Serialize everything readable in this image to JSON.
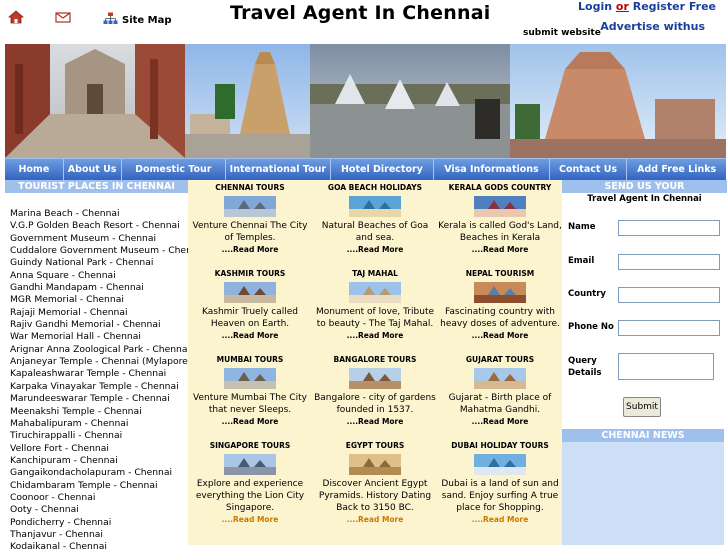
{
  "header": {
    "home_icon": "home-icon",
    "mail_icon": "mail-icon",
    "sitemap_icon": "sitemap-icon",
    "sitemap_label": "Site Map",
    "title": "Travel Agent In Chennai",
    "login_label": "Login",
    "or_label": "or",
    "register_label": "Register Free",
    "advertise_label": "Advertise withus",
    "submit_website_label": "submit website"
  },
  "nav": {
    "items": [
      "Home",
      "About Us",
      "Domestic Tour",
      "International Tour",
      "Hotel Directory",
      "Visa Informations",
      "Contact Us",
      "Add Free Links"
    ]
  },
  "left": {
    "heading": "TOURIST PLACES IN CHENNAI",
    "places": [
      "Marina Beach - Chennai",
      "V.G.P Golden Beach Resort - Chennai",
      "Government Museum - Chennai",
      "Cuddalore Government Museum - Chennai",
      "Guindy National Park - Chennai",
      "Anna Square - Chennai",
      "Gandhi Mandapam - Chennai",
      "MGR Memorial - Chennai",
      "Rajaji Memorial - Chennai",
      "Rajiv Gandhi Memorial - Chennai",
      "War Memorial Hall - Chennai",
      "Arignar Anna Zoological Park - Chennai",
      "Anjaneyar Temple - Chennai (Mylapore)",
      "Kapaleashwarar Temple - Chennai",
      "Karpaka Vinayakar Temple - Chennai",
      "Marundeeswarar Temple - Chennai",
      "Meenakshi Temple - Chennai",
      "Mahabalipuram - Chennai",
      "Tiruchirappalli - Chennai",
      "Vellore Fort - Chennai",
      "Kanchipuram - Chennai",
      "Gangaikondacholapuram - Chennai",
      "Chidambaram Temple - Chennai",
      "Coonoor - Chennai",
      "Ooty - Chennai",
      "Pondicherry - Chennai",
      "Thanjavur - Chennai",
      "Kodaikanal - Chennai"
    ]
  },
  "tours": [
    {
      "title": "CHENNAI TOURS",
      "desc": "Venture Chennai The City of Temples.",
      "more": "....Read More"
    },
    {
      "title": "GOA BEACH HOLIDAYS",
      "desc": "Natural Beaches of Goa and sea.",
      "more": "....Read More"
    },
    {
      "title": "KERALA GODS COUNTRY",
      "desc": "Kerala is called God's Land, Beaches in Kerala",
      "more": "....Read More"
    },
    {
      "title": "KASHMIR TOURS",
      "desc": "Kashmir Truely called Heaven on Earth.",
      "more": "....Read More"
    },
    {
      "title": "TAJ MAHAL",
      "desc": "Monument of love, Tribute to beauty - The Taj Mahal.",
      "more": "....Read More"
    },
    {
      "title": "NEPAL TOURISM",
      "desc": "Fascinating country with heavy doses of adventure.",
      "more": "....Read More"
    },
    {
      "title": "MUMBAI TOURS",
      "desc": "Venture Mumbai The City that never Sleeps.",
      "more": "....Read More"
    },
    {
      "title": "BANGALORE TOURS",
      "desc": "Bangalore - city of gardens founded in 1537.",
      "more": "....Read More"
    },
    {
      "title": "GUJARAT TOURS",
      "desc": "Gujarat - Birth place of Mahatma Gandhi.",
      "more": "....Read More"
    },
    {
      "title": "SINGAPORE TOURS",
      "desc": "Explore and experience everything the Lion City Singapore.",
      "more": "....Read More"
    },
    {
      "title": "EGYPT TOURS",
      "desc": "Discover Ancient Egypt Pyramids. History Dating Back to 3150 BC.",
      "more": "....Read More"
    },
    {
      "title": "DUBAI HOLIDAY TOURS",
      "desc": "Dubai is a land of sun and sand. Enjoy surfing A true place for Shopping.",
      "more": "....Read More"
    }
  ],
  "form": {
    "heading": "SEND US YOUR REQUIREMENTS",
    "subheading": "Travel Agent In Chennai",
    "name_label": "Name",
    "email_label": "Email",
    "country_label": "Country",
    "phone_label": "Phone No",
    "query_label": "Query Details",
    "submit_label": "Submit"
  },
  "news": {
    "heading": "CHENNAI NEWS"
  },
  "colors": {
    "nav_top": "#6f9de0",
    "nav_bottom": "#2f61bf",
    "section_header": "#9fc0ec",
    "tours_bg": "#fcf3cf",
    "news_bg": "#cddff7",
    "link_blue": "#1a3f9c",
    "read_more_orange": "#c97a00"
  }
}
